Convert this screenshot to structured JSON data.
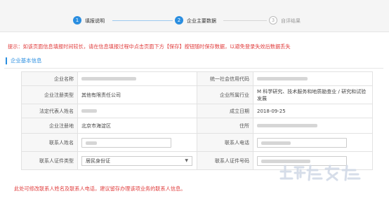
{
  "steps": [
    {
      "number": "1",
      "label": "填报说明",
      "state": "active"
    },
    {
      "number": "2",
      "label": "企业主要数据",
      "state": "active"
    },
    {
      "number": "3",
      "label": "自评结果",
      "state": "todo"
    }
  ],
  "tip": "提示：如该页面信息填报时间较长，请在信息填报过程中点击页面下方【保存】按钮随时保存数据，以避免登录失效后数据丢失",
  "section_title": "企业基本信息",
  "form": {
    "company_name_label": "企业名称",
    "credit_code_label": "统一社会信用代码",
    "reg_type_label": "企业注册类型",
    "reg_type_value": "其他有限责任公司",
    "industry_label": "企业所属行业",
    "industry_value": "M 科学研究、技术服务和地质勘查业 / 研究和试验发展",
    "legal_rep_label": "法定代表人姓名",
    "founded_label": "成立日期",
    "founded_value": "2018-09-25",
    "reg_place_label": "企业注册地",
    "reg_place_value": "北京市海淀区",
    "address_label": "住所",
    "contact_name_label": "联系人姓名",
    "contact_phone_label": "联系人电话",
    "id_type_label": "联系人证件类型",
    "id_type_value": "居民身份证",
    "id_no_label": "联系人证件号码"
  },
  "bottom_note": "此处可修改联系人姓名及联系人电话，建议留存办理该项业务的联系人信息。",
  "watermark_image": "logo-watermark"
}
